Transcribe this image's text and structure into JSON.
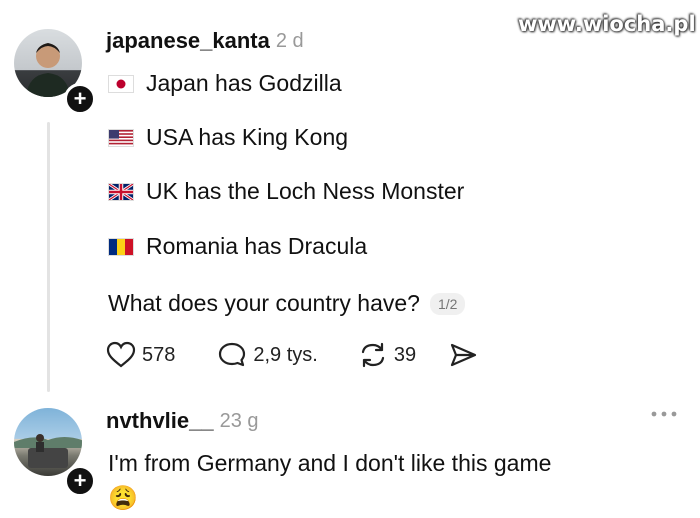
{
  "watermark": "www.wiocha.pl",
  "post": {
    "username": "japanese_kanta",
    "time": "2 d",
    "lines": [
      {
        "flag": "japan-flag-icon",
        "text": "Japan has Godzilla"
      },
      {
        "flag": "usa-flag-icon",
        "text": "USA has King Kong"
      },
      {
        "flag": "uk-flag-icon",
        "text": "UK has the Loch Ness Monster"
      },
      {
        "flag": "romania-flag-icon",
        "text": "Romania has Dracula"
      }
    ],
    "question": "What does your country have?",
    "pager": "1/2",
    "likes": "578",
    "comments": "2,9 tys.",
    "reposts": "39"
  },
  "reply": {
    "username": "nvthvlie__",
    "time": "23 g",
    "text": "I'm from Germany and I don't like this game",
    "emoji": "😩"
  }
}
